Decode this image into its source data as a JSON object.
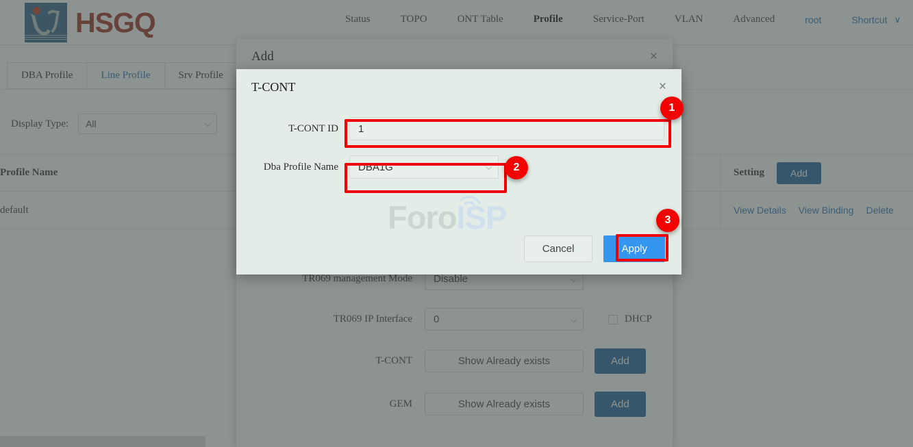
{
  "header": {
    "logo_text": "HSGQ",
    "nav": [
      {
        "label": "Status",
        "active": false,
        "link": false
      },
      {
        "label": "TOPO",
        "active": false,
        "link": false
      },
      {
        "label": "ONT Table",
        "active": false,
        "link": false
      },
      {
        "label": "Profile",
        "active": true,
        "link": false
      },
      {
        "label": "Service-Port",
        "active": false,
        "link": false
      },
      {
        "label": "VLAN",
        "active": false,
        "link": false
      },
      {
        "label": "Advanced",
        "active": false,
        "link": false
      },
      {
        "label": "root",
        "active": false,
        "link": true
      },
      {
        "label": "Shortcut",
        "active": false,
        "link": true
      }
    ],
    "shortcut_caret": "∨"
  },
  "tabs": [
    {
      "label": "DBA Profile",
      "active": false
    },
    {
      "label": "Line Profile",
      "active": true
    },
    {
      "label": "Srv Profile",
      "active": false
    }
  ],
  "filter": {
    "label": "Display Type:",
    "value": "All"
  },
  "table": {
    "columns": [
      "Profile Name",
      "Setting"
    ],
    "header_add_button": "Add",
    "rows": [
      {
        "profile_name": "default",
        "actions": [
          "View Details",
          "View Binding",
          "Delete"
        ]
      }
    ]
  },
  "add_dialog": {
    "title": "Add",
    "close_icon": "×",
    "fields": [
      {
        "label": "TR069 management Mode",
        "value": "Disable",
        "type": "select"
      },
      {
        "label": "TR069 IP Interface",
        "value": "0",
        "type": "select",
        "checkbox_label": "DHCP",
        "checkbox_checked": false
      },
      {
        "label": "T-CONT",
        "value": "Show Already exists",
        "type": "text",
        "button": "Add"
      },
      {
        "label": "GEM",
        "value": "Show Already exists",
        "type": "text",
        "button": "Add"
      }
    ]
  },
  "tcont_dialog": {
    "title": "T-CONT",
    "close_icon": "×",
    "tcont_id_label": "T-CONT ID",
    "tcont_id_value": "1",
    "dba_profile_label": "Dba Profile Name",
    "dba_profile_value": "DBA1G",
    "cancel_label": "Cancel",
    "apply_label": "Apply"
  },
  "watermark": {
    "part1": "Foro",
    "part2": "ISP"
  },
  "annotations": [
    {
      "number": "1",
      "target": "tcont-id-input"
    },
    {
      "number": "2",
      "target": "dba-profile-select"
    },
    {
      "number": "3",
      "target": "apply-button"
    }
  ],
  "colors": {
    "accent_blue": "#1f5f9e",
    "apply_blue": "#3596f0",
    "link_blue": "#2f6fb5",
    "annotation_red": "#f50000",
    "brand_red": "#9e2a20",
    "dialog_bg": "#e3ece7"
  }
}
